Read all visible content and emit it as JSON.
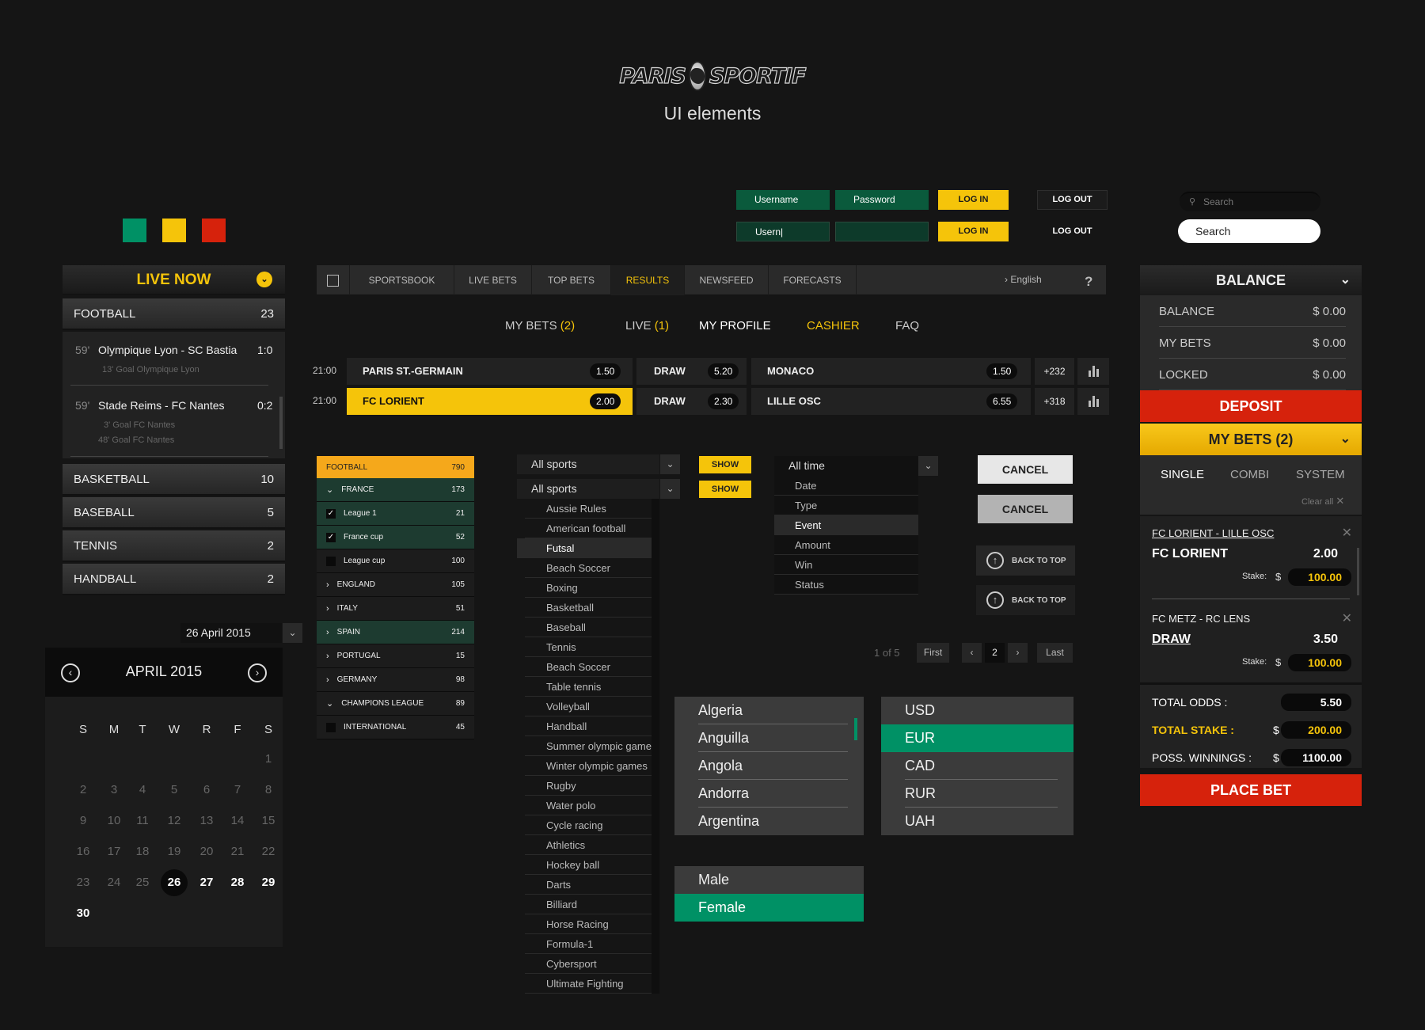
{
  "brand": {
    "logo_left": "PARIS",
    "logo_right": "SPORTIF",
    "subtitle": "UI elements"
  },
  "colors": {
    "green": "#009165",
    "yellow": "#f5c40a",
    "red": "#d6220c"
  },
  "login": {
    "row1": {
      "username": "Username",
      "password": "Password",
      "login": "LOG IN",
      "logout": "LOG OUT"
    },
    "row2": {
      "username": "Usern|",
      "password": "",
      "login": "LOG IN",
      "logout": "LOG OUT"
    }
  },
  "search": {
    "placeholder_dark": "Search",
    "placeholder_light": "Search"
  },
  "live": {
    "title": "LIVE NOW",
    "sports_top": {
      "name": "FOOTBALL",
      "count": "23"
    },
    "matches": [
      {
        "minute": "59'",
        "teams": "Olympique Lyon - SC Bastia",
        "score": "1:0",
        "events": [
          "13' Goal Olympique Lyon"
        ]
      },
      {
        "minute": "59'",
        "teams": "Stade Reims - FC Nantes",
        "score": "0:2",
        "events": [
          "3' Goal FC Nantes",
          "48' Goal FC Nantes"
        ]
      }
    ],
    "sports": [
      {
        "name": "BASKETBALL",
        "count": "10"
      },
      {
        "name": "BASEBALL",
        "count": "5"
      },
      {
        "name": "TENNIS",
        "count": "2"
      },
      {
        "name": "HANDBALL",
        "count": "2"
      }
    ]
  },
  "datepicker": {
    "value": "26 April 2015",
    "month": "APRIL 2015",
    "weekdays": [
      "S",
      "M",
      "T",
      "W",
      "R",
      "F",
      "S"
    ],
    "days": [
      [
        "",
        "",
        "",
        "",
        "",
        "",
        "1"
      ],
      [
        "2",
        "3",
        "4",
        "5",
        "6",
        "7",
        "8"
      ],
      [
        "9",
        "10",
        "11",
        "12",
        "13",
        "14",
        "15"
      ],
      [
        "16",
        "17",
        "18",
        "19",
        "20",
        "21",
        "22"
      ],
      [
        "23",
        "24",
        "25",
        "26",
        "27",
        "28",
        "29"
      ],
      [
        "30",
        "",
        "",
        "",
        "",
        "",
        ""
      ]
    ],
    "selected": "26"
  },
  "nav": {
    "tabs": [
      "SPORTSBOOK",
      "LIVE BETS",
      "TOP BETS",
      "RESULTS",
      "NEWSFEED",
      "FORECASTS"
    ],
    "active": "RESULTS",
    "language": "English",
    "help": "?"
  },
  "subnav": {
    "my_bets": "MY BETS",
    "my_bets_count": "(2)",
    "live": "LIVE",
    "live_count": "(1)",
    "profile": "MY PROFILE",
    "cashier": "CASHIER",
    "faq": "FAQ"
  },
  "odds": [
    {
      "time": "21:00",
      "home": "PARIS ST.-GERMAIN",
      "home_odd": "1.50",
      "draw": "DRAW",
      "draw_odd": "5.20",
      "away": "MONACO",
      "away_odd": "1.50",
      "more": "+232"
    },
    {
      "time": "21:00",
      "home": "FC LORIENT",
      "home_odd": "2.00",
      "draw": "DRAW",
      "draw_odd": "2.30",
      "away": "LILLE OSC",
      "away_odd": "6.55",
      "more": "+318"
    }
  ],
  "tree": {
    "head": {
      "name": "FOOTBALL",
      "count": "790"
    },
    "rows": [
      {
        "name": "FRANCE",
        "count": "173"
      },
      {
        "name": "League 1",
        "count": "21"
      },
      {
        "name": "France cup",
        "count": "52"
      },
      {
        "name": "League cup",
        "count": "100"
      },
      {
        "name": "ENGLAND",
        "count": "105"
      },
      {
        "name": "ITALY",
        "count": "51"
      },
      {
        "name": "SPAIN",
        "count": "214"
      },
      {
        "name": "PORTUGAL",
        "count": "15"
      },
      {
        "name": "GERMANY",
        "count": "98"
      },
      {
        "name": "CHAMPIONS LEAGUE",
        "count": "89"
      },
      {
        "name": "INTERNATIONAL",
        "count": "45"
      }
    ]
  },
  "sports_dd": {
    "value": "All sports",
    "value2": "All sports",
    "options": [
      "Aussie Rules",
      "American football",
      "Futsal",
      "Beach Soccer",
      "Boxing",
      "Basketball",
      "Baseball",
      "Tennis",
      "Beach Soccer",
      "Table tennis",
      "Volleyball",
      "Handball",
      "Summer olympic games",
      "Winter olympic games",
      "Rugby",
      "Water polo",
      "Cycle racing",
      "Athletics",
      "Hockey ball",
      "Darts",
      "Billiard",
      "Horse Racing",
      "Formula-1",
      "Cybersport",
      "Ultimate Fighting"
    ]
  },
  "show": "SHOW",
  "time_dd": {
    "value": "All time",
    "options": [
      "Date",
      "Type",
      "Event",
      "Amount",
      "Win",
      "Status"
    ]
  },
  "cancel": "CANCEL",
  "back_to_top": "BACK TO TOP",
  "pagination": {
    "info": "1 of 5",
    "first": "First",
    "page": "2",
    "last": "Last"
  },
  "countries": [
    "Algeria",
    "Anguilla",
    "Angola",
    "Andorra",
    "Argentina"
  ],
  "currencies": [
    "USD",
    "EUR",
    "CAD",
    "RUR",
    "UAH"
  ],
  "genders": [
    "Male",
    "Female"
  ],
  "balance": {
    "title": "BALANCE",
    "rows": [
      {
        "label": "BALANCE",
        "value": "$ 0.00"
      },
      {
        "label": "MY BETS",
        "value": "$ 0.00"
      },
      {
        "label": "LOCKED",
        "value": "$ 0.00"
      }
    ],
    "deposit": "DEPOSIT",
    "mybets": "MY BETS (2)",
    "tabs": [
      "SINGLE",
      "COMBI",
      "SYSTEM"
    ],
    "clear": "Clear all",
    "bets": [
      {
        "match": "FC LORIENT - LILLE OSC",
        "pick": "FC LORIENT",
        "odd": "2.00",
        "stake_label": "Stake:",
        "cur": "$",
        "stake": "100.00"
      },
      {
        "match": "FC METZ - RC LENS",
        "pick": "DRAW",
        "odd": "3.50",
        "stake_label": "Stake:",
        "cur": "$",
        "stake": "100.00"
      }
    ],
    "total_odds_label": "TOTAL ODDS :",
    "total_odds": "5.50",
    "total_stake_label": "TOTAL STAKE :",
    "total_stake": "200.00",
    "poss_label": "POSS. WINNINGS :",
    "poss": "1100.00",
    "cur": "$",
    "place": "PLACE BET"
  }
}
